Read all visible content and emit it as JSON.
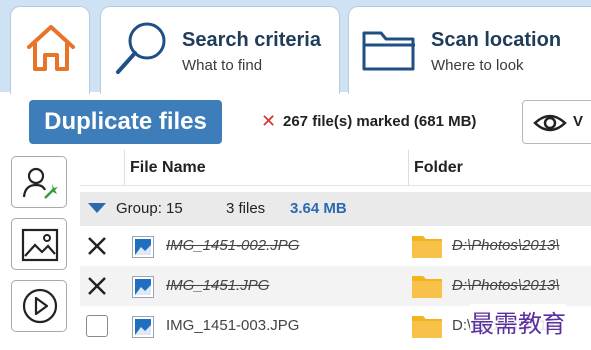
{
  "tabs": {
    "home": {
      "icon": "home-icon"
    },
    "search": {
      "title": "Search criteria",
      "subtitle": "What to find",
      "icon": "search-icon"
    },
    "scan": {
      "title": "Scan location",
      "subtitle": "Where to look",
      "icon": "folder-icon"
    }
  },
  "toolbar": {
    "duplicate_label": "Duplicate files",
    "marked_text": "267 file(s) marked (681 MB)",
    "view_label": "V"
  },
  "sidebar": {
    "buttons": [
      "user-filter",
      "image-filter",
      "media-play"
    ]
  },
  "table": {
    "columns": {
      "filename": "File Name",
      "folder": "Folder"
    },
    "group": {
      "label": "Group: 15",
      "files": "3 files",
      "size": "3.64 MB"
    },
    "rows": [
      {
        "name": "IMG_1451-002.JPG",
        "folder": "D:\\Photos\\2013\\",
        "checked": true,
        "strike": true
      },
      {
        "name": "IMG_1451.JPG",
        "folder": "D:\\Photos\\2013\\",
        "checked": true,
        "strike": true
      },
      {
        "name": "IMG_1451-003.JPG",
        "folder": "D:\\Photos\\2013\\",
        "checked": false,
        "strike": false
      }
    ]
  },
  "watermark": "最需教育",
  "colors": {
    "accent": "#3d7db9",
    "topbar": "#cfe2f3",
    "home_icon": "#e8742a",
    "folder": "#f5b21f",
    "marked_x": "#d8322e"
  }
}
